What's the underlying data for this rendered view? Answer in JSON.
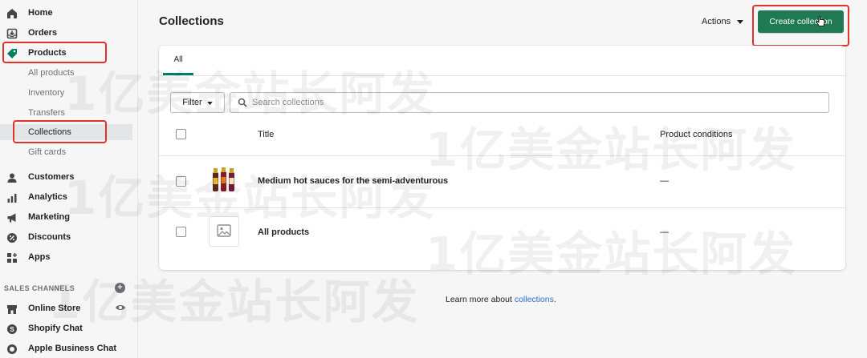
{
  "sidebar": {
    "items": [
      {
        "label": "Home",
        "icon": "home-icon"
      },
      {
        "label": "Orders",
        "icon": "orders-icon"
      },
      {
        "label": "Products",
        "icon": "tag-icon"
      },
      {
        "label": "Customers",
        "icon": "person-icon"
      },
      {
        "label": "Analytics",
        "icon": "bar-chart-icon"
      },
      {
        "label": "Marketing",
        "icon": "megaphone-icon"
      },
      {
        "label": "Discounts",
        "icon": "discount-icon"
      },
      {
        "label": "Apps",
        "icon": "apps-icon"
      }
    ],
    "products_sub": [
      "All products",
      "Inventory",
      "Transfers",
      "Collections",
      "Gift cards"
    ],
    "active_sub": "Collections",
    "sales_channels_title": "SALES CHANNELS",
    "channels": [
      {
        "label": "Online Store",
        "icon": "store-icon"
      },
      {
        "label": "Shopify Chat",
        "icon": "chat-icon"
      },
      {
        "label": "Apple Business Chat",
        "icon": "apple-chat-icon"
      }
    ]
  },
  "header": {
    "title": "Collections",
    "actions_label": "Actions",
    "create_label": "Create collection"
  },
  "tabs": {
    "all": "All"
  },
  "filter": {
    "label": "Filter"
  },
  "search": {
    "placeholder": "Search collections"
  },
  "table": {
    "headers": {
      "title": "Title",
      "conditions": "Product conditions"
    },
    "rows": [
      {
        "title": "Medium hot sauces for the semi-adventurous",
        "conditions": "—"
      },
      {
        "title": "All products",
        "conditions": "—"
      }
    ]
  },
  "footer": {
    "learn_prefix": "Learn more about ",
    "learn_link": "collections",
    "learn_suffix": "."
  },
  "watermark": "1亿美金站长阿发",
  "colors": {
    "primary": "#1f7a53",
    "highlight": "#e0322b",
    "link": "#2c6ecb"
  }
}
